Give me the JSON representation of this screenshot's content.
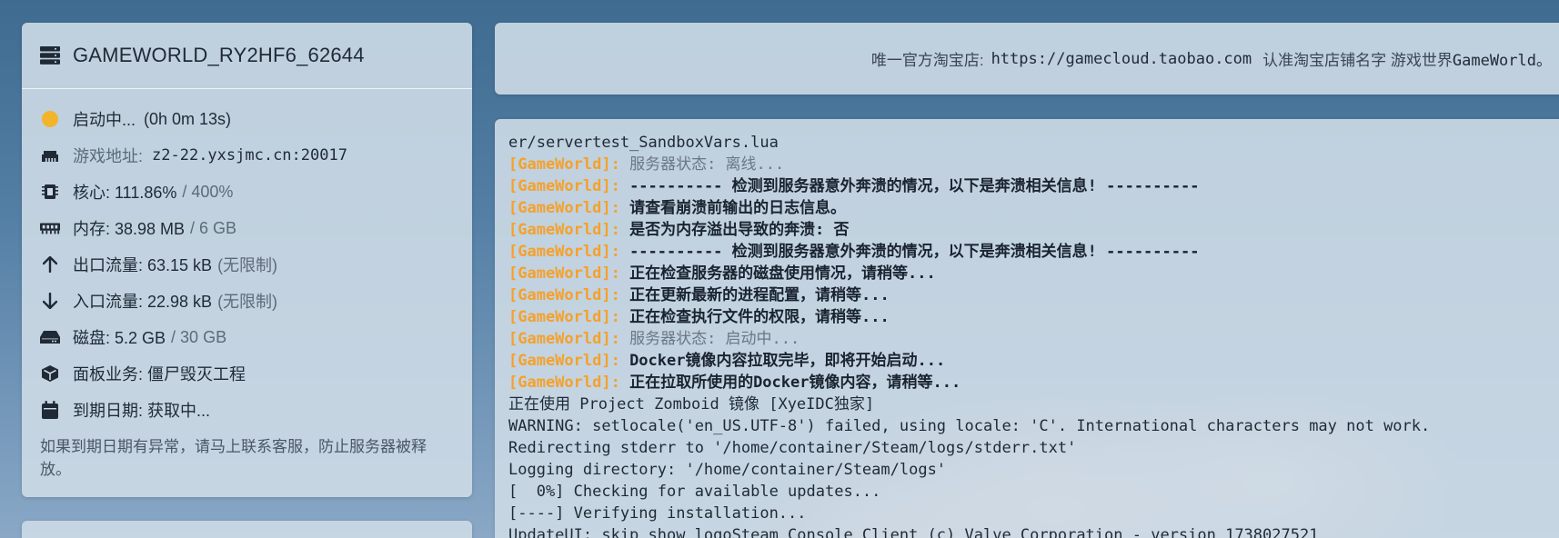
{
  "server": {
    "name": "GAMEWORLD_RY2HF6_62644",
    "status_text": "启动中...",
    "uptime": "(0h 0m 13s)",
    "address_label": "游戏地址:",
    "address_value": "z2-22.yxsjmc.cn:20017",
    "cpu_label": "核心: 111.86%",
    "cpu_limit": "/ 400%",
    "memory_label": "内存: 38.98 MB",
    "memory_limit": "/ 6 GB",
    "outbound_label": "出口流量: 63.15 kB",
    "outbound_limit": "(无限制)",
    "inbound_label": "入口流量: 22.98 kB",
    "inbound_limit": "(无限制)",
    "disk_label": "磁盘: 5.2 GB",
    "disk_limit": "/ 30 GB",
    "panel_business": "面板业务: 僵尸毁灭工程",
    "expiry": "到期日期: 获取中...",
    "notice": "如果到期日期有异常，请马上联系客服，防止服务器被释放。"
  },
  "banner": {
    "prefix": "唯一官方淘宝店:",
    "url": "https://gamecloud.taobao.com",
    "mid": "认准淘宝店铺名字 游戏世界",
    "brand": "GameWorld。"
  },
  "colors": {
    "status_starting": "#f2b42a",
    "tag": "#f5a12b"
  },
  "console": {
    "lines": [
      {
        "tag": "",
        "text": "er/servertest_SandboxVars.lua",
        "style": "plain"
      },
      {
        "tag": "[GameWorld]:",
        "text": " 服务器状态: 离线...",
        "style": "gray"
      },
      {
        "tag": "[GameWorld]:",
        "text": " ---------- 检测到服务器意外奔溃的情况，以下是奔溃相关信息! ----------",
        "style": "bold"
      },
      {
        "tag": "[GameWorld]:",
        "text": " 请查看崩溃前输出的日志信息。",
        "style": "bold"
      },
      {
        "tag": "[GameWorld]:",
        "text": " 是否为内存溢出导致的奔溃: 否",
        "style": "bold"
      },
      {
        "tag": "[GameWorld]:",
        "text": " ---------- 检测到服务器意外奔溃的情况，以下是奔溃相关信息! ----------",
        "style": "bold"
      },
      {
        "tag": "[GameWorld]:",
        "text": " 正在检查服务器的磁盘使用情况，请稍等...",
        "style": "bold"
      },
      {
        "tag": "[GameWorld]:",
        "text": " 正在更新最新的进程配置，请稍等...",
        "style": "bold"
      },
      {
        "tag": "[GameWorld]:",
        "text": " 正在检查执行文件的权限，请稍等...",
        "style": "bold"
      },
      {
        "tag": "[GameWorld]:",
        "text": " 服务器状态: 启动中...",
        "style": "gray"
      },
      {
        "tag": "[GameWorld]:",
        "text": " Docker镜像内容拉取完毕，即将开始启动...",
        "style": "bold"
      },
      {
        "tag": "[GameWorld]:",
        "text": " 正在拉取所使用的Docker镜像内容，请稍等...",
        "style": "bold"
      },
      {
        "tag": "",
        "text": "正在使用 Project Zomboid 镜像 [XyeIDC独家]",
        "style": "plain"
      },
      {
        "tag": "",
        "text": "WARNING: setlocale('en_US.UTF-8') failed, using locale: 'C'. International characters may not work.",
        "style": "plain"
      },
      {
        "tag": "",
        "text": "Redirecting stderr to '/home/container/Steam/logs/stderr.txt'",
        "style": "plain"
      },
      {
        "tag": "",
        "text": "Logging directory: '/home/container/Steam/logs'",
        "style": "plain"
      },
      {
        "tag": "",
        "text": "[  0%] Checking for available updates...",
        "style": "plain"
      },
      {
        "tag": "",
        "text": "[----] Verifying installation...",
        "style": "plain"
      },
      {
        "tag": "",
        "text": "UpdateUI: skip show logoSteam Console Client (c) Valve Corporation - version 1738027521",
        "style": "plain"
      }
    ]
  }
}
